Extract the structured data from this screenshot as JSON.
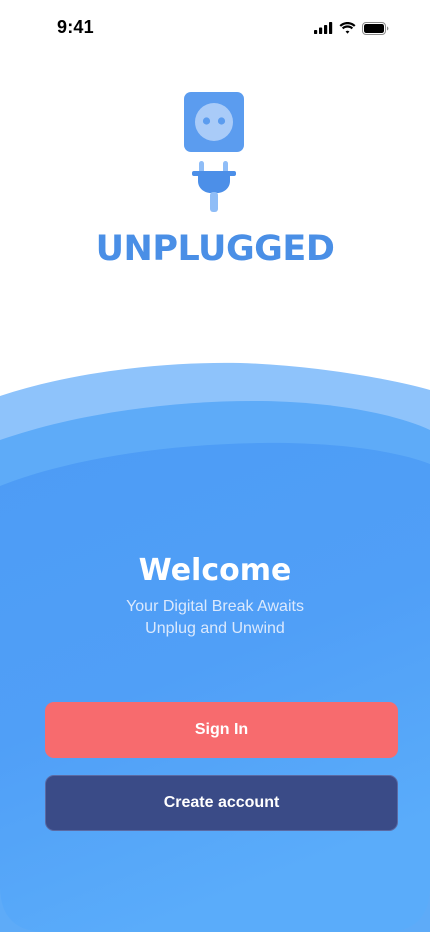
{
  "status_bar": {
    "time": "9:41",
    "icons": [
      "cellular-signal-icon",
      "wifi-icon",
      "battery-icon"
    ]
  },
  "logo": {
    "icons": [
      "socket-icon",
      "plug-icon"
    ]
  },
  "brand": {
    "name": "UNPLUGGED"
  },
  "welcome": {
    "title": "Welcome",
    "subtitle_line1": "Your Digital Break Awaits",
    "subtitle_line2": "Unplug and Unwind"
  },
  "actions": {
    "sign_in_label": "Sign In",
    "create_account_label": "Create account"
  },
  "colors": {
    "brand_blue": "#4a8fe6",
    "wave_light": "#8ec3fb",
    "wave_mid": "#5eabf8",
    "wave_main": "#4f9ef6",
    "sign_in_bg": "#f76b6e",
    "create_account_bg": "#3a4b87"
  }
}
